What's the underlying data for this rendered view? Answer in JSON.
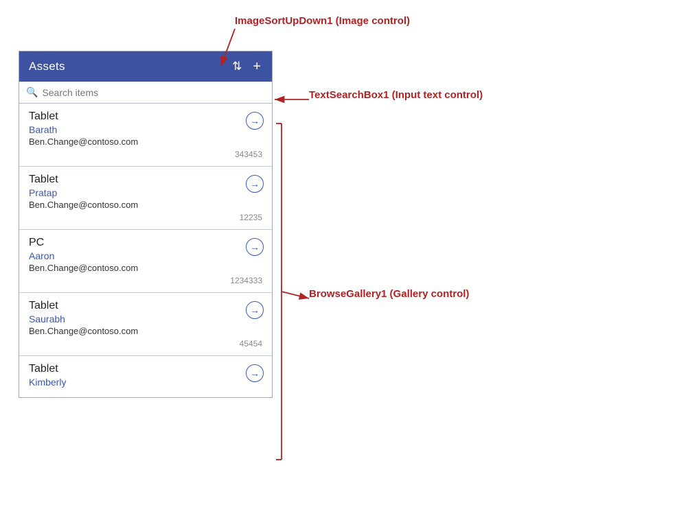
{
  "header": {
    "title": "Assets",
    "sort_icon": "⇅",
    "add_icon": "+"
  },
  "search": {
    "placeholder": "Search items"
  },
  "items": [
    {
      "type": "Tablet",
      "name": "Barath",
      "email": "Ben.Change@contoso.com",
      "number": "343453"
    },
    {
      "type": "Tablet",
      "name": "Pratap",
      "email": "Ben.Change@contoso.com",
      "number": "12235"
    },
    {
      "type": "PC",
      "name": "Aaron",
      "email": "Ben.Change@contoso.com",
      "number": "1234333"
    },
    {
      "type": "Tablet",
      "name": "Saurabh",
      "email": "Ben.Change@contoso.com",
      "number": "45454"
    },
    {
      "type": "Tablet",
      "name": "Kimberly",
      "email": "",
      "number": ""
    }
  ],
  "annotations": {
    "sort_label": "ImageSortUpDown1 (Image control)",
    "search_label": "TextSearchBox1 (Input text control)",
    "gallery_label": "BrowseGallery1 (Gallery control)"
  }
}
